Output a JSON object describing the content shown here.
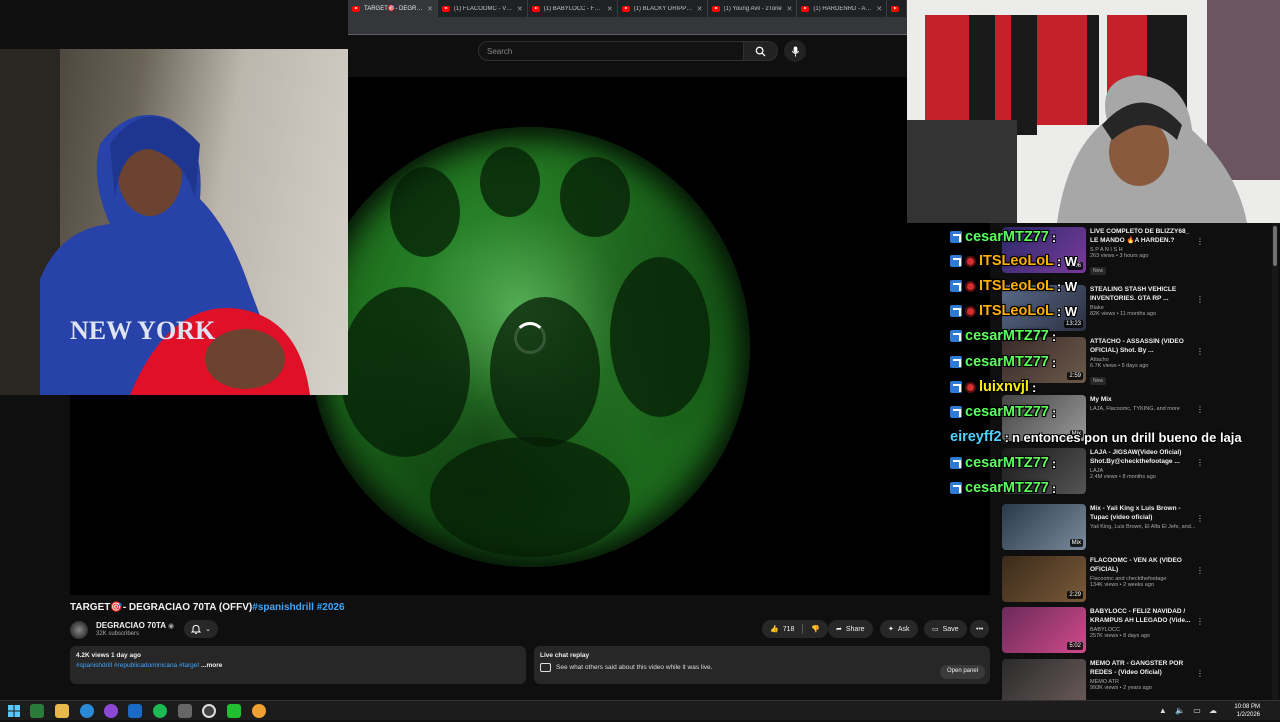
{
  "browser": {
    "tabs": [
      {
        "label": "TARGET🎯- DEGRACIAO 70TA",
        "active": true
      },
      {
        "label": "(1) FLACOOMC - VEN AK",
        "active": false
      },
      {
        "label": "(1) BABYLOCC - FELIZ NAVIDAD",
        "active": false
      },
      {
        "label": "(1) BLACKY DRIPPY - A",
        "active": false
      },
      {
        "label": "(1) Young Avii - 2Tone",
        "active": false
      },
      {
        "label": "(1) HARDENRD - ARMA",
        "active": false
      },
      {
        "label": "(1)",
        "active": false
      }
    ]
  },
  "header": {
    "search_placeholder": "Search"
  },
  "video": {
    "title": "TARGET🎯- DEGRACIAO 70TA (OFFV)",
    "title_tags": "#spanishdrill #2026",
    "channel": "DEGRACIAO 70TA",
    "subscribers": "32K subscribers",
    "likes": "718",
    "share_label": "Share",
    "ask_label": "Ask",
    "save_label": "Save",
    "description_meta": "4.2K views  1 day ago",
    "description_tags": "#spanishdrill #republicadominicana #target",
    "more_label": "...more",
    "live_chat_title": "Live chat replay",
    "live_chat_desc": "See what others said about this video while it was live.",
    "open_panel_label": "Open panel"
  },
  "sidebar": {
    "recommendations": [
      {
        "title": "LIVE COMPLETO DE BLIZZY68_ LE MANDO 🔥A HARDEN.?",
        "channel": "S P A N I S H",
        "views": "263 views • 3 hours ago",
        "badge": "New",
        "duration": "4:06",
        "colors": [
          "#2a2a6a",
          "#7a3a9a"
        ]
      },
      {
        "title": "STEALING STASH VEHICLE INVENTORIES. GTA RP ...",
        "channel": "Blake",
        "views": "82K views • 11 months ago",
        "badge": "",
        "duration": "13:23",
        "colors": [
          "#5a6a8a",
          "#2a3040"
        ]
      },
      {
        "title": "ATTACHO - ASSASSIN (VIDEO OFICIAL) Shot. By ...",
        "channel": "Attacho",
        "views": "6.7K views • 5 days ago",
        "badge": "New",
        "duration": "2:59",
        "colors": [
          "#3a2a2a",
          "#6a5a4a"
        ]
      },
      {
        "title": "My Mix",
        "channel": "LAJA, Flacoomc, TYKING, and more",
        "views": "",
        "badge": "",
        "duration": "Mix",
        "colors": [
          "#444",
          "#999"
        ]
      },
      {
        "title": "LAJA - JIGSAW(Video Oficial) Shot.By@checkthefootage ...",
        "channel": "LAJA",
        "views": "2.4M views • 8 months ago",
        "badge": "",
        "duration": "",
        "colors": [
          "#1a1a1a",
          "#555"
        ]
      },
      {
        "title": "Mix - Yaii King x Luis Brown - Tupac (video oficial)",
        "channel": "Yaii King, Luis Brown, El Alfa El Jefe, and...",
        "views": "",
        "badge": "",
        "duration": "Mix",
        "colors": [
          "#2a3a4a",
          "#7a8a9a"
        ]
      },
      {
        "title": "FLACOOMC - VEN AK (VIDEO OFICIAL)",
        "channel": "Flacoomc and checkthefootage",
        "views": "134K views • 2 weeks ago",
        "badge": "",
        "duration": "2:29",
        "colors": [
          "#3a2a1a",
          "#7a5a3a"
        ]
      },
      {
        "title": "BABYLOCC - FELIZ NAVIDAD / KRAMPUS AH LLEGADO (Vide...",
        "channel": "BABYLOCC",
        "views": "257K views • 8 days ago",
        "badge": "",
        "duration": "5:02",
        "colors": [
          "#6a2a5a",
          "#d04a8a"
        ]
      },
      {
        "title": "MEMO ATR - GANGSTER POR REDES - (Video Oficial)",
        "channel": "MEMO ATR",
        "views": "993K views • 2 years ago",
        "badge": "",
        "duration": "",
        "colors": [
          "#2a2a2a",
          "#6a5a5a"
        ]
      }
    ]
  },
  "chat_overlay": [
    {
      "user": "cesarMTZ77",
      "sep": ":",
      "message": "",
      "color": "#5aff5a",
      "mod": false
    },
    {
      "user": "ITSLeoLoL",
      "sep": ": W",
      "message": "",
      "color": "#ffb000",
      "mod": true
    },
    {
      "user": "ITSLeoLoL",
      "sep": ": W",
      "message": "",
      "color": "#ffb000",
      "mod": true
    },
    {
      "user": "ITSLeoLoL",
      "sep": ": W",
      "message": "",
      "color": "#ffb000",
      "mod": true
    },
    {
      "user": "cesarMTZ77",
      "sep": ":",
      "message": "",
      "color": "#5aff5a",
      "mod": false
    },
    {
      "user": "cesarMTZ77",
      "sep": ":",
      "message": "",
      "color": "#5aff5a",
      "mod": false
    },
    {
      "user": "luixnvjl",
      "sep": ":",
      "message": "",
      "color": "#ffee00",
      "mod": true
    },
    {
      "user": "cesarMTZ77",
      "sep": ":",
      "message": "",
      "color": "#5aff5a",
      "mod": false
    },
    {
      "user": "eireyff2",
      "sep": ":",
      "message": "n entonces pon un drill bueno de laja",
      "color": "#4ad3ff",
      "mod": false
    },
    {
      "user": "cesarMTZ77",
      "sep": ":",
      "message": "",
      "color": "#5aff5a",
      "mod": false
    },
    {
      "user": "cesarMTZ77",
      "sep": ":",
      "message": "",
      "color": "#5aff5a",
      "mod": false
    }
  ],
  "taskbar": {
    "time": "10:08 PM",
    "date": "1/2/2026"
  }
}
